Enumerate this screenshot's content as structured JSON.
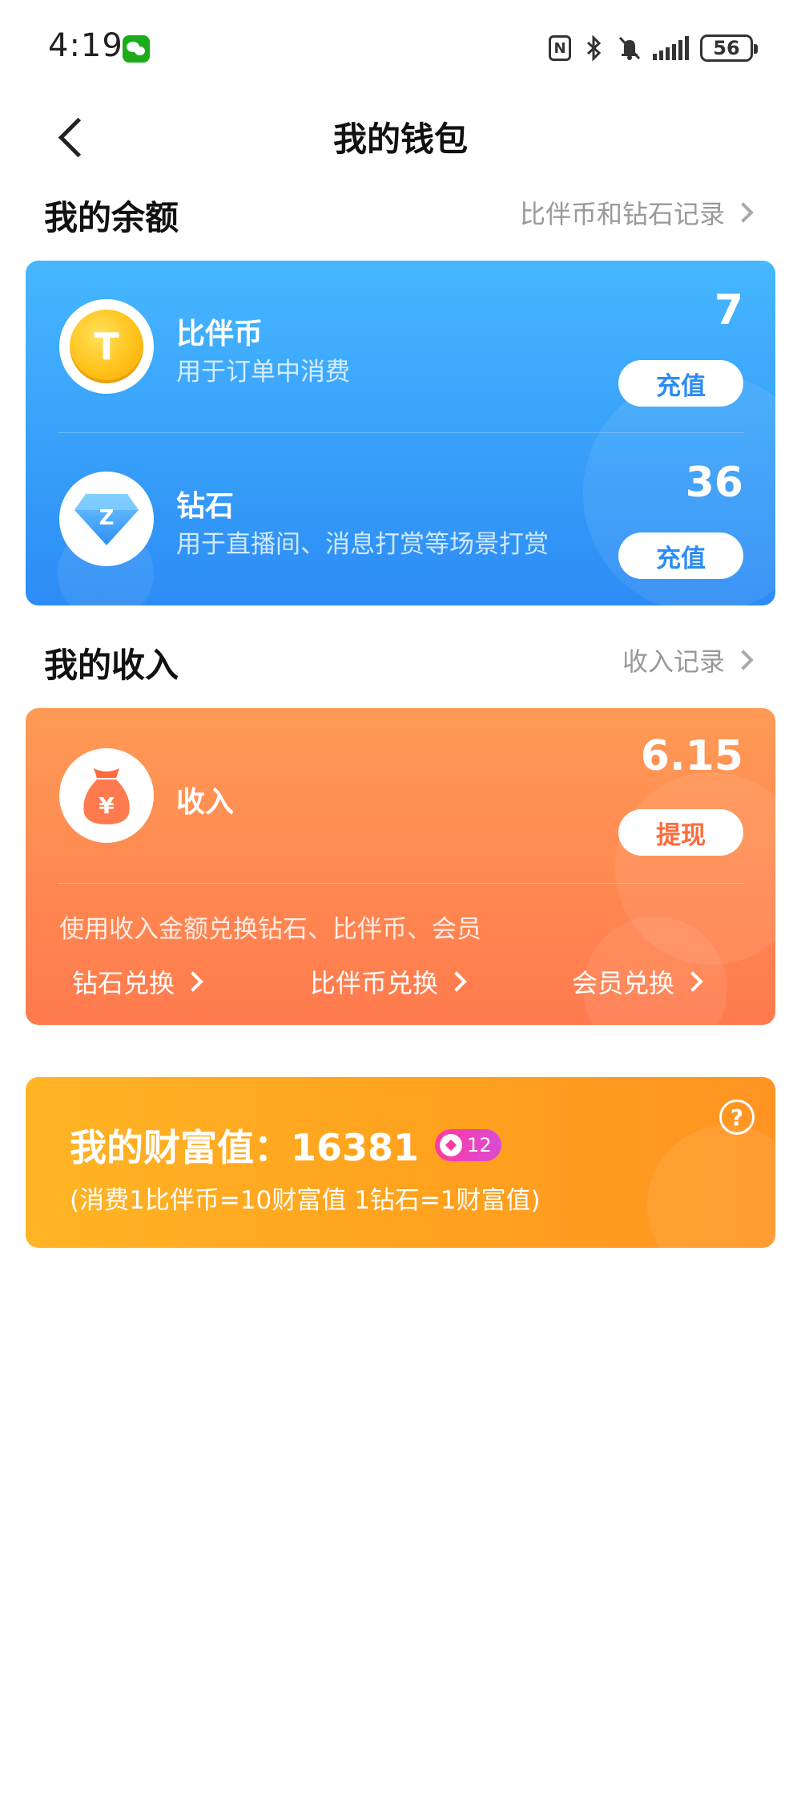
{
  "status_bar": {
    "time": "4:19",
    "battery": "56"
  },
  "header": {
    "title": "我的钱包"
  },
  "balance_section": {
    "title": "我的余额",
    "link": "比伴币和钻石记录"
  },
  "balance_card": {
    "coin": {
      "icon_letter": "T",
      "title": "比伴币",
      "subtitle": "用于订单中消费",
      "value": "7",
      "button": "充值"
    },
    "diamond": {
      "icon_letter": "Z",
      "title": "钻石",
      "subtitle": "用于直播间、消息打赏等场景打赏",
      "value": "36",
      "button": "充值"
    }
  },
  "income_section": {
    "title": "我的收入",
    "link": "收入记录"
  },
  "income_card": {
    "title": "收入",
    "value": "6.15",
    "button": "提现",
    "note": "使用收入金额兑换钻石、比伴币、会员",
    "exchanges": [
      {
        "label": "钻石兑换"
      },
      {
        "label": "比伴币兑换"
      },
      {
        "label": "会员兑换"
      }
    ]
  },
  "wealth_card": {
    "title": "我的财富值：16381",
    "level": "12",
    "subtitle": "(消费1比伴币=10财富值 1钻石=1财富值)",
    "help": "?"
  },
  "colors": {
    "blue_card": "#2c8cf5",
    "orange_card": "#ff7a4e",
    "yellow_card": "#ffa31e",
    "level_badge": "#ff3aa0"
  }
}
